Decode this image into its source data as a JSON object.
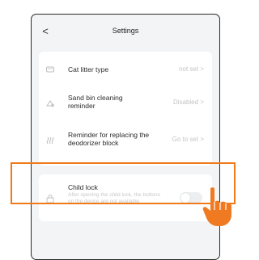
{
  "nav": {
    "title": "Settings",
    "back_glyph": "<"
  },
  "rows": [
    {
      "icon": "litter-box-icon",
      "label": "Cat litter type",
      "value": "not set",
      "chev": ">"
    },
    {
      "icon": "bin-cleaning-icon",
      "label": "Sand bin cleaning reminder",
      "value": "Disabled",
      "chev": ">"
    },
    {
      "icon": "deodorizer-icon",
      "label": "Reminder for replacing the deodorizer block",
      "value": "Go to set",
      "chev": ">"
    }
  ],
  "child_lock": {
    "icon": "child-lock-icon",
    "label": "Child lock",
    "description": "After opening the child lock, the buttons on the device are not available",
    "enabled": false
  },
  "colors": {
    "highlight": "#f07a1a",
    "hand": "#ef7a22",
    "screen_bg": "#f3f4f6"
  }
}
